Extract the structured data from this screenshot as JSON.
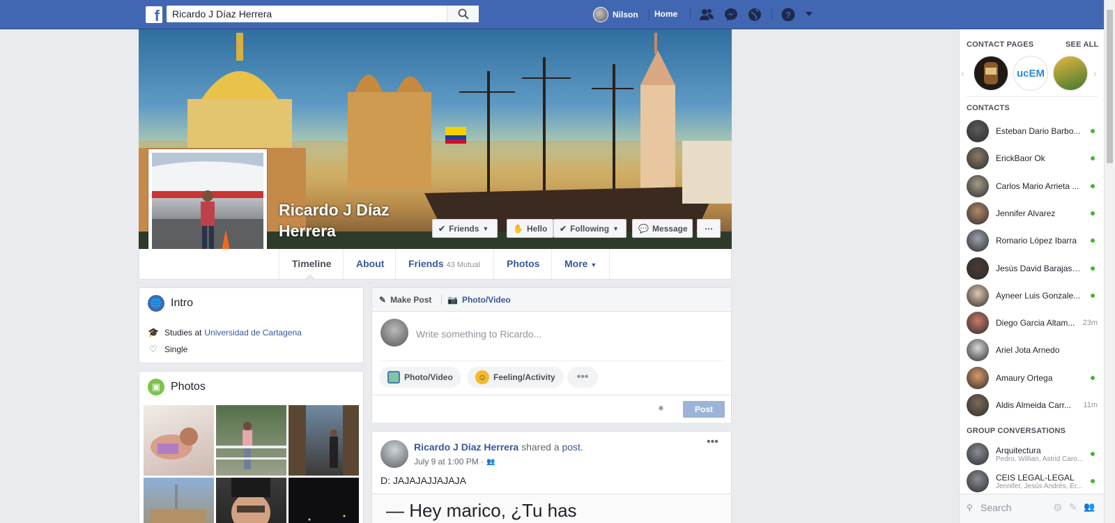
{
  "topbar": {
    "search_value": "Ricardo J Díaz Herrera",
    "user_name": "Nilson",
    "home_label": "Home"
  },
  "profile": {
    "name": "Ricardo J Díaz Herrera",
    "buttons": {
      "friends": "Friends",
      "hello": "Hello",
      "following": "Following",
      "message": "Message"
    },
    "tabs": {
      "timeline": "Timeline",
      "about": "About",
      "friends": "Friends",
      "friends_mutual": "43 Mutual",
      "photos": "Photos",
      "more": "More"
    }
  },
  "intro": {
    "title": "Intro",
    "studies_prefix": "Studies at",
    "studies_link": "Universidad de Cartagena",
    "relationship": "Single"
  },
  "photos": {
    "title": "Photos"
  },
  "composer": {
    "make_post": "Make Post",
    "photo_video_tab": "Photo/Video",
    "placeholder": "Write something to Ricardo...",
    "photo_video_btn": "Photo/Video",
    "feeling": "Feeling/Activity",
    "post_btn": "Post"
  },
  "post": {
    "author": "Ricardo J Díaz Herrera",
    "action_prefix": "shared a",
    "action_link": "post.",
    "timestamp": "July 9 at 1:00 PM ·",
    "text": "D: JAJAJAJJAJAJA",
    "shared_text": "— Hey marico, ¿Tu has"
  },
  "sidebar": {
    "contact_pages_label": "CONTACT PAGES",
    "see_all": "SEE ALL",
    "pages": [
      "",
      "ucEM",
      ""
    ],
    "contacts_label": "CONTACTS",
    "contacts": [
      {
        "name": "Esteban Dario Barbo...",
        "status": "",
        "online": true
      },
      {
        "name": "ErickBaor Ok",
        "status": "",
        "online": true
      },
      {
        "name": "Carlos Mario Arrieta ...",
        "status": "",
        "online": true
      },
      {
        "name": "Jennifer Alvarez",
        "status": "",
        "online": true
      },
      {
        "name": "Romario López Ibarra",
        "status": "",
        "online": true
      },
      {
        "name": "Jesús David Barajas ...",
        "status": "",
        "online": true
      },
      {
        "name": "Ayneer Luis Gonzale...",
        "status": "",
        "online": true
      },
      {
        "name": "Diego Garcia Altam...",
        "status": "23m",
        "online": false
      },
      {
        "name": "Ariel Jota Arnedo",
        "status": "",
        "online": false
      },
      {
        "name": "Amaury Ortega",
        "status": "",
        "online": true
      },
      {
        "name": "Aldis Almeida Carr...",
        "status": "11m",
        "online": false
      }
    ],
    "group_label": "GROUP CONVERSATIONS",
    "groups": [
      {
        "name": "Arquitectura",
        "members": "Pedro, Willian, Astrid Caro...",
        "online": true
      },
      {
        "name": "CEIS LEGAL-LEGAL",
        "members": "Jennifer, Jesús Andrés, Er...",
        "online": true
      }
    ],
    "search_placeholder": "Search"
  },
  "colors": {
    "brand": "#4267b2",
    "link": "#365899",
    "online": "#42b72a"
  }
}
